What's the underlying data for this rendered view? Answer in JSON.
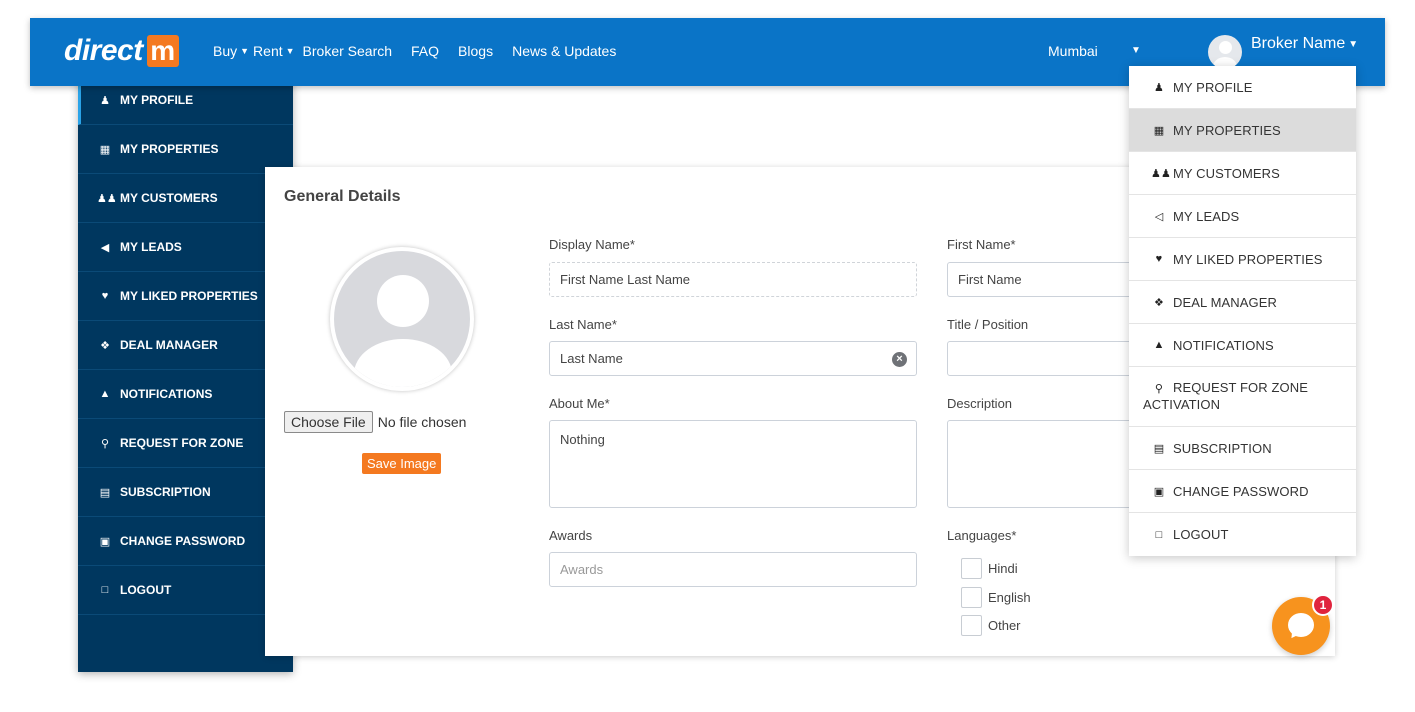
{
  "header": {
    "logo_text": "direct",
    "logo_mark": "m",
    "nav": [
      {
        "label": "Buy",
        "dropdown": true
      },
      {
        "label": "Rent",
        "dropdown": true
      },
      {
        "label": "Broker Search",
        "dropdown": false
      },
      {
        "label": "FAQ",
        "dropdown": false
      },
      {
        "label": "Blogs",
        "dropdown": false
      },
      {
        "label": "News & Updates",
        "dropdown": false
      }
    ],
    "city": "Mumbai",
    "user_name": "Broker Name",
    "colors": {
      "bar": "#0a74c7",
      "accent": "#f47920"
    }
  },
  "sidebar": {
    "items": [
      {
        "label": "MY PROFILE",
        "icon": "user-icon"
      },
      {
        "label": "MY PROPERTIES",
        "icon": "building-icon"
      },
      {
        "label": "MY CUSTOMERS",
        "icon": "users-icon"
      },
      {
        "label": "MY LEADS",
        "icon": "bullhorn-icon"
      },
      {
        "label": "MY LIKED PROPERTIES",
        "icon": "heart-icon"
      },
      {
        "label": "DEAL MANAGER",
        "icon": "handshake-icon"
      },
      {
        "label": "NOTIFICATIONS",
        "icon": "bell-icon"
      },
      {
        "label": "REQUEST FOR ZONE",
        "icon": "key-icon"
      },
      {
        "label": "SUBSCRIPTION",
        "icon": "id-card-icon"
      },
      {
        "label": "CHANGE PASSWORD",
        "icon": "lock-icon"
      },
      {
        "label": "LOGOUT",
        "icon": "unlock-icon"
      }
    ]
  },
  "profile": {
    "title": "General Details",
    "choose_file": "Choose File",
    "no_file": "No file chosen",
    "save_image": "Save Image",
    "display_name": {
      "label": "Display Name*",
      "value": "First Name Last Name"
    },
    "first_name": {
      "label": "First Name*",
      "value": "First Name"
    },
    "last_name": {
      "label": "Last Name*",
      "value": "Last Name"
    },
    "title_position": {
      "label": "Title / Position",
      "value": ""
    },
    "about_me": {
      "label": "About Me*",
      "value": "Nothing"
    },
    "description": {
      "label": "Description",
      "value": ""
    },
    "awards": {
      "label": "Awards",
      "placeholder": "Awards"
    },
    "languages": {
      "label": "Languages*",
      "options": [
        "Hindi",
        "English",
        "Other"
      ]
    }
  },
  "dropdown": {
    "items": [
      {
        "label": "MY PROFILE",
        "icon": "user-icon"
      },
      {
        "label": "MY PROPERTIES",
        "icon": "building-icon",
        "active": true
      },
      {
        "label": "MY CUSTOMERS",
        "icon": "users-icon"
      },
      {
        "label": "MY LEADS",
        "icon": "bullhorn-icon"
      },
      {
        "label": "MY LIKED PROPERTIES",
        "icon": "heart-icon"
      },
      {
        "label": "DEAL MANAGER",
        "icon": "handshake-icon"
      },
      {
        "label": "NOTIFICATIONS",
        "icon": "bell-icon"
      },
      {
        "label_line1": "REQUEST FOR ZONE",
        "label_line2": "ACTIVATION",
        "icon": "key-icon"
      },
      {
        "label": "SUBSCRIPTION",
        "icon": "id-card-icon"
      },
      {
        "label": "CHANGE PASSWORD",
        "icon": "lock-icon"
      },
      {
        "label": "LOGOUT",
        "icon": "unlock-icon"
      }
    ]
  },
  "chat": {
    "badge": "1",
    "color": "#f7931e"
  }
}
